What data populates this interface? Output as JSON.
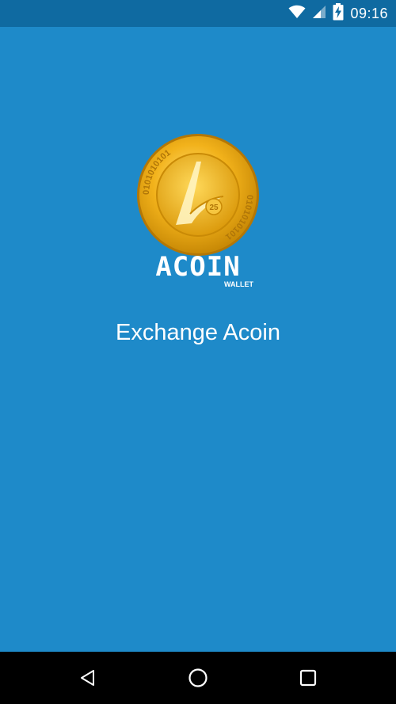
{
  "status_bar": {
    "time": "09:16",
    "icons": [
      "wifi-icon",
      "signal-icon",
      "battery-charging-icon"
    ]
  },
  "logo": {
    "brand": "ACOIN",
    "subtitle": "WALLET",
    "coin_digits_top": "0101010101",
    "coin_digits_bottom": "0101010101",
    "coin_badge": "25"
  },
  "main": {
    "title": "Exchange Acoin"
  },
  "nav_bar": {
    "buttons": [
      "back-icon",
      "home-icon",
      "recents-icon"
    ]
  },
  "colors": {
    "background": "#1e8ac9",
    "status_bar": "#0f6aa1",
    "nav_bar": "#000000",
    "coin_gold": "#f2b21b"
  }
}
